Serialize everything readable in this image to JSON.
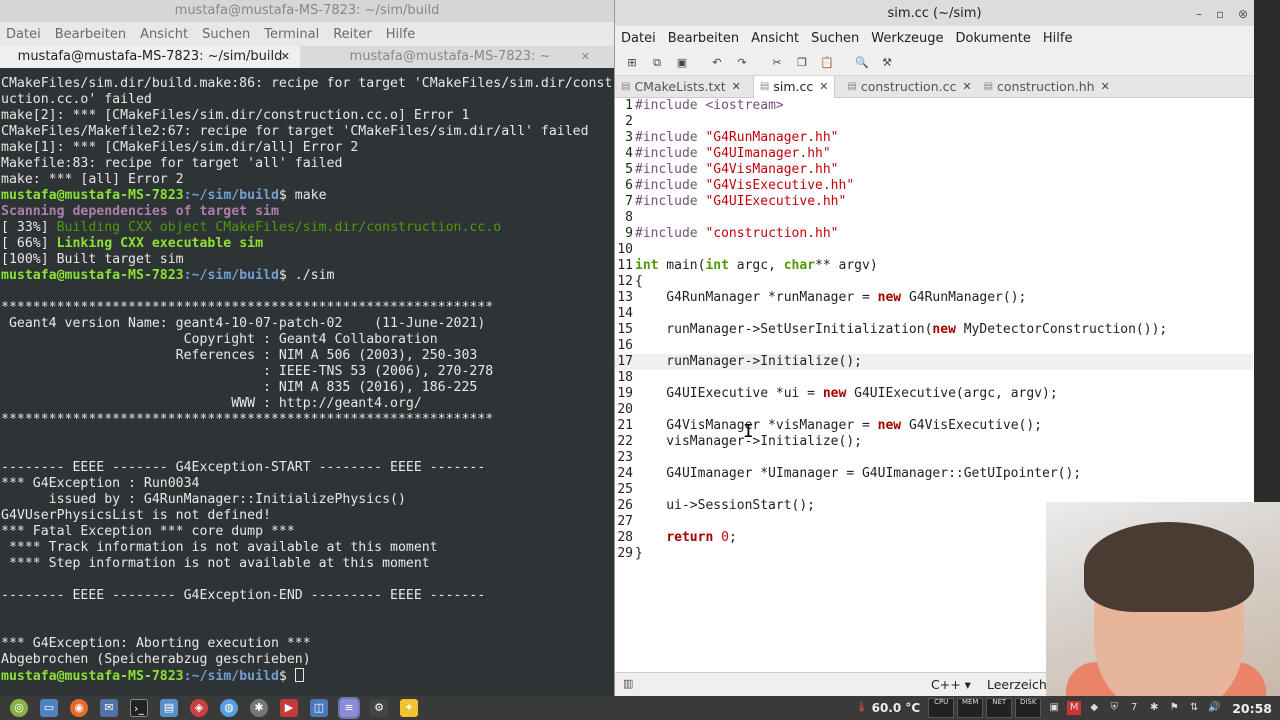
{
  "terminal": {
    "title": "mustafa@mustafa-MS-7823: ~/sim/build",
    "menu": [
      "Datei",
      "Bearbeiten",
      "Ansicht",
      "Suchen",
      "Terminal",
      "Reiter",
      "Hilfe"
    ],
    "tabs": [
      {
        "label": "mustafa@mustafa-MS-7823: ~/sim/build",
        "active": true
      },
      {
        "label": "mustafa@mustafa-MS-7823: ~",
        "active": false
      }
    ],
    "prompt_user": "mustafa@mustafa-MS-7823",
    "prompt_path": ":~/sim/build",
    "lines": [
      "CMakeFiles/sim.dir/build.make:86: recipe for target 'CMakeFiles/sim.dir/const",
      "uction.cc.o' failed",
      "make[2]: *** [CMakeFiles/sim.dir/construction.cc.o] Error 1",
      "CMakeFiles/Makefile2:67: recipe for target 'CMakeFiles/sim.dir/all' failed",
      "make[1]: *** [CMakeFiles/sim.dir/all] Error 2",
      "Makefile:83: recipe for target 'all' failed",
      "make: *** [all] Error 2"
    ],
    "cmd_make": "$ make",
    "scanning": "Scanning dependencies of target sim",
    "build33_pre": "[ 33%] ",
    "build33": "Building CXX object CMakeFiles/sim.dir/construction.cc.o",
    "build66_pre": "[ 66%] ",
    "build66": "Linking CXX executable sim",
    "build100": "[100%] Built target sim",
    "cmd_run": "$ ./sim",
    "geant_lines": [
      "",
      "**************************************************************",
      " Geant4 version Name: geant4-10-07-patch-02    (11-June-2021)",
      "                       Copyright : Geant4 Collaboration",
      "                      References : NIM A 506 (2003), 250-303",
      "                                 : IEEE-TNS 53 (2006), 270-278",
      "                                 : NIM A 835 (2016), 186-225",
      "                             WWW : http://geant4.org/",
      "**************************************************************",
      "",
      "",
      "-------- EEEE ------- G4Exception-START -------- EEEE -------",
      "*** G4Exception : Run0034",
      "      issued by : G4RunManager::InitializePhysics()",
      "G4VUserPhysicsList is not defined!",
      "*** Fatal Exception *** core dump ***",
      " **** Track information is not available at this moment",
      " **** Step information is not available at this moment",
      "",
      "-------- EEEE -------- G4Exception-END --------- EEEE -------",
      "",
      "",
      "*** G4Exception: Aborting execution ***",
      "Abgebrochen (Speicherabzug geschrieben)"
    ],
    "final_prompt": "$ "
  },
  "editor": {
    "title": "sim.cc (~/sim)",
    "menu": [
      "Datei",
      "Bearbeiten",
      "Ansicht",
      "Suchen",
      "Werkzeuge",
      "Dokumente",
      "Hilfe"
    ],
    "tabs": [
      {
        "label": "CMakeLists.txt",
        "active": false
      },
      {
        "label": "sim.cc",
        "active": true
      },
      {
        "label": "construction.cc",
        "active": false
      },
      {
        "label": "construction.hh",
        "active": false
      }
    ],
    "language": "C++ ▾",
    "spaces": "Leerzeichen:",
    "current_line": 17
  },
  "taskbar": {
    "temperature": "60.0 °C",
    "monitors": [
      "CPU",
      "MEM",
      "NET",
      "DISK"
    ],
    "clock": "20:58",
    "workspace": "7"
  }
}
